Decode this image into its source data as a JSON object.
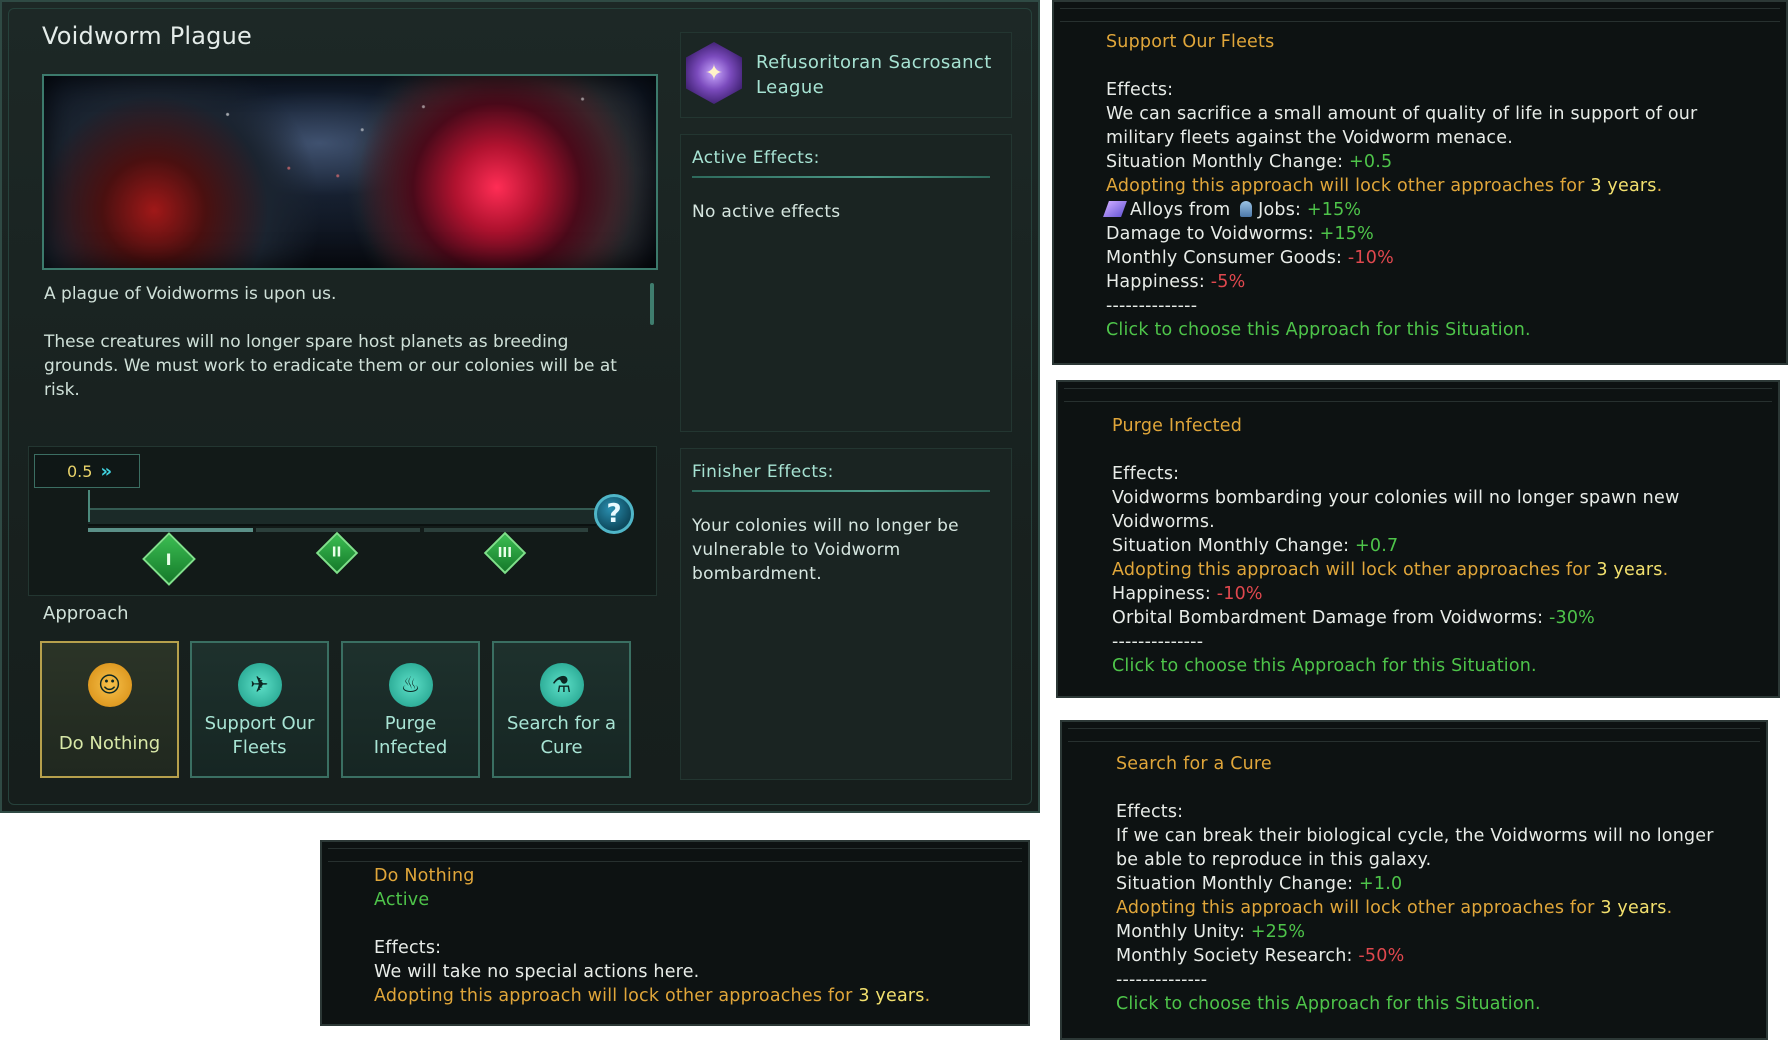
{
  "window": {
    "title": "Voidworm Plague",
    "description_1": "A plague of Voidworms is upon us.",
    "description_2": "These creatures will no longer spare host planets as breeding grounds. We must work to eradicate them or our colonies will be at risk."
  },
  "progress": {
    "monthly_change": "0.5",
    "fill_fraction": 0.33,
    "help_label": "?",
    "milestones": [
      "I",
      "II",
      "III"
    ]
  },
  "approach": {
    "label": "Approach",
    "options": [
      {
        "label": "Do Nothing",
        "icon": "do-nothing-icon",
        "active": true
      },
      {
        "label": "Support Our Fleets",
        "icon": "fleet-icon",
        "active": false
      },
      {
        "label": "Purge Infected",
        "icon": "purge-icon",
        "active": false
      },
      {
        "label": "Search for a Cure",
        "icon": "microscope-icon",
        "active": false
      }
    ]
  },
  "empire": {
    "name": "Refusoritoran Sacrosanct League",
    "emblem_icon": "empire-emblem-icon"
  },
  "active_effects": {
    "header": "Active Effects:",
    "text": "No active effects"
  },
  "finisher_effects": {
    "header": "Finisher Effects:",
    "text": "Your colonies will no longer be vulnerable to Voidworm bombardment."
  },
  "tooltips": {
    "support": {
      "title": "Support Our Fleets",
      "effects_label": "Effects:",
      "desc": "We can sacrifice a small amount of quality of life in support of our military fleets against the Voidworm menace.",
      "monthly_change_label": "Situation Monthly Change:",
      "monthly_change_value": "+0.5",
      "lock_text": "Adopting this approach will lock other approaches for",
      "lock_years": "3 years",
      "lock_end": ".",
      "alloys_label": "Alloys from",
      "jobs_label": "Jobs:",
      "alloys_value": "+15%",
      "damage_label": "Damage to Voidworms:",
      "damage_value": "+15%",
      "consumer_label": "Monthly Consumer Goods:",
      "consumer_value": "-10%",
      "happiness_label": "Happiness:",
      "happiness_value": "-5%",
      "separator": "--------------",
      "click_text": "Click to choose this Approach for this Situation."
    },
    "purge": {
      "title": "Purge Infected",
      "effects_label": "Effects:",
      "desc": "Voidworms bombarding your colonies will no longer spawn new Voidworms.",
      "monthly_change_label": "Situation Monthly Change:",
      "monthly_change_value": "+0.7",
      "lock_text": "Adopting this approach will lock other approaches for",
      "lock_years": "3 years",
      "lock_end": ".",
      "happiness_label": "Happiness:",
      "happiness_value": "-10%",
      "orbital_label": "Orbital Bombardment Damage from Voidworms:",
      "orbital_value": "-30%",
      "separator": "--------------",
      "click_text": "Click to choose this Approach for this Situation."
    },
    "cure": {
      "title": "Search for a Cure",
      "effects_label": "Effects:",
      "desc": "If we can break their biological cycle, the Voidworms will no longer be able to reproduce in this galaxy.",
      "monthly_change_label": "Situation Monthly Change:",
      "monthly_change_value": "+1.0",
      "lock_text": "Adopting this approach will lock other approaches for",
      "lock_years": "3 years",
      "lock_end": ".",
      "unity_label": "Monthly Unity:",
      "unity_value": "+25%",
      "research_label": "Monthly Society Research:",
      "research_value": "-50%",
      "separator": "--------------",
      "click_text": "Click to choose this Approach for this Situation."
    },
    "nothing": {
      "title": "Do Nothing",
      "status": "Active",
      "effects_label": "Effects:",
      "desc": "We will take no special actions here.",
      "lock_text": "Adopting this approach will lock other approaches for",
      "lock_years": "3 years",
      "lock_end": "."
    }
  },
  "colors": {
    "accent_teal": "#a6e2d2",
    "tooltip_title": "#e0a63a",
    "positive": "#4ec44a",
    "negative": "#e0484e",
    "highlight": "#f2e06e"
  }
}
